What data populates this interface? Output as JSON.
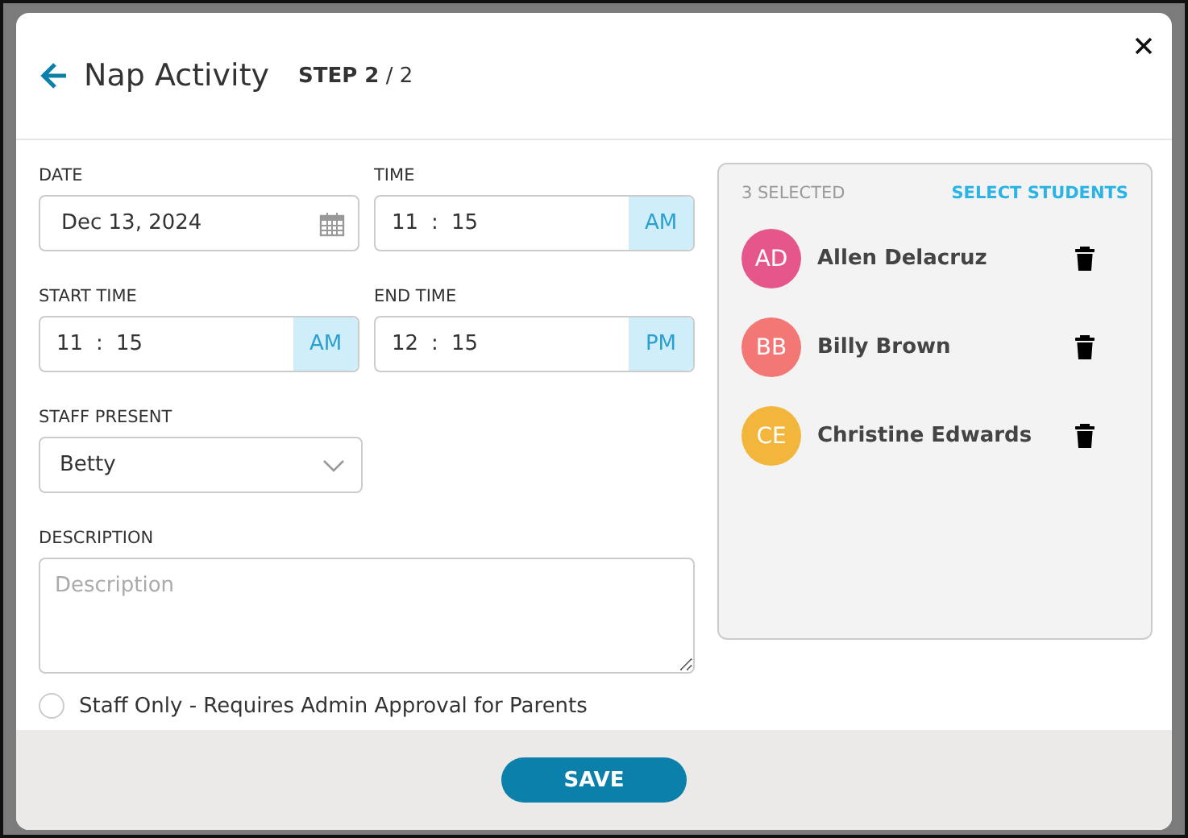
{
  "dialog": {
    "title": "Nap Activity",
    "step_label": "STEP",
    "step_current": "2",
    "step_total": "/ 2"
  },
  "fields": [
    {
      "kind": "date",
      "label": "DATE",
      "value": "Dec 13, 2024"
    },
    {
      "kind": "time",
      "label": "TIME",
      "hour": "11",
      "separator": ":",
      "minute": "15",
      "period": "AM"
    },
    {
      "kind": "time",
      "label": "START TIME",
      "hour": "11",
      "separator": ":",
      "minute": "15",
      "period": "AM"
    },
    {
      "kind": "time",
      "label": "END TIME",
      "hour": "12",
      "separator": ":",
      "minute": "15",
      "period": "PM"
    },
    {
      "kind": "select",
      "label": "STAFF PRESENT",
      "value": "Betty"
    }
  ],
  "description": {
    "label": "DESCRIPTION",
    "placeholder": "Description"
  },
  "staff_only": {
    "label": "Staff Only - Requires Admin Approval for Parents",
    "checked": false
  },
  "students": {
    "count": "3 SELECTED",
    "action": "SELECT STUDENTS",
    "items": [
      {
        "initials": "AD",
        "name": "Allen Delacruz",
        "color": "#e5578a"
      },
      {
        "initials": "BB",
        "name": "Billy Brown",
        "color": "#f37775"
      },
      {
        "initials": "CE",
        "name": "Christine Edwards",
        "color": "#f2b63d"
      }
    ]
  },
  "buttons": [
    "SAVE"
  ]
}
